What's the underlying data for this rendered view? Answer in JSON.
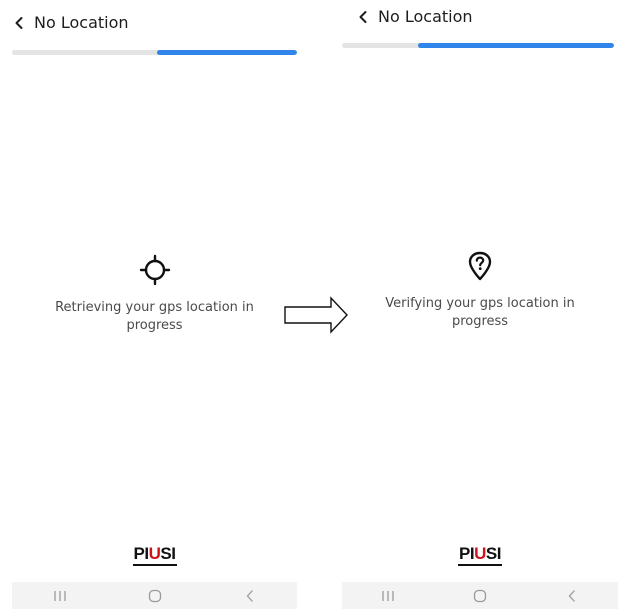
{
  "screens": [
    {
      "title": "No Location",
      "progress_fraction": 0.49,
      "status_icon": "gps-crosshair-icon",
      "status_text": "Retrieving your gps location in progress"
    },
    {
      "title": "No Location",
      "progress_fraction": 0.72,
      "status_icon": "location-question-icon",
      "status_text": "Verifying your gps location in progress"
    }
  ],
  "brand": {
    "prefix": "PI",
    "mid": "U",
    "suffix": "SI"
  },
  "colors": {
    "accent": "#2f86e8",
    "brand_red": "#d0121a",
    "track": "#e4e4e4"
  },
  "icons": {
    "back": "chevron-left-icon",
    "transition": "right-arrow-icon",
    "nav": [
      "recents-icon",
      "home-icon",
      "back-icon"
    ]
  }
}
